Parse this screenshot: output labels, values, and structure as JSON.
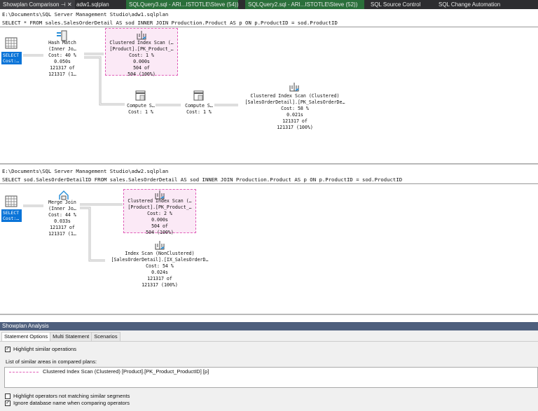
{
  "tabs": [
    {
      "label": "Showplan Comparison",
      "pin": "⊣",
      "close": "✕"
    },
    {
      "label": "adw1.sqlplan"
    },
    {
      "label": "SQLQuery3.sql - ARI...ISTOTLE\\Steve (54))"
    },
    {
      "label": "SQLQuery2.sql - ARI...ISTOTLE\\Steve (52))"
    },
    {
      "label": "SQL Source Control"
    },
    {
      "label": "SQL Change Automation"
    }
  ],
  "plan1": {
    "path": "E:\\Documents\\SQL Server Management Studio\\adw1.sqlplan",
    "query": "SELECT * FROM sales.SalesOrderDetail AS sod INNER JOIN Production.Product AS p ON p.ProductID = sod.ProductID",
    "select": {
      "l1": "SELECT",
      "l2": "Cost:…"
    },
    "hash": {
      "l1": "Hash Match",
      "l2": "(Inner Jo…",
      "l3": "Cost: 40 %",
      "l4": "0.050s",
      "l5": "121317 of",
      "l6": "121317 (1…"
    },
    "cis_product": {
      "l1": "Clustered Index Scan (…",
      "l2": "[Product].[PK_Product_…",
      "l3": "Cost: 1 %",
      "l4": "0.000s",
      "l5": "504 of",
      "l6": "504 (100%)"
    },
    "compute1": {
      "l1": "Compute S…",
      "l2": "Cost: 1 %"
    },
    "compute2": {
      "l1": "Compute S…",
      "l2": "Cost: 1 %"
    },
    "cis_sod": {
      "l1": "Clustered Index Scan (Clustered)",
      "l2": "[SalesOrderDetail].[PK_SalesOrderDe…",
      "l3": "Cost: 58 %",
      "l4": "0.021s",
      "l5": "121317 of",
      "l6": "121317 (100%)"
    }
  },
  "plan2": {
    "path": "E:\\Documents\\SQL Server Management Studio\\adw2.sqlplan",
    "query": "SELECT sod.SalesOrderDetailID FROM sales.SalesOrderDetail AS sod INNER JOIN Production.Product AS p ON p.ProductID = sod.ProductID",
    "select": {
      "l1": "SELECT",
      "l2": "Cost:…"
    },
    "merge": {
      "l1": "Merge Join",
      "l2": "(Inner Jo…",
      "l3": "Cost: 44 %",
      "l4": "0.033s",
      "l5": "121317 of",
      "l6": "121317 (1…"
    },
    "cis_product": {
      "l1": "Clustered Index Scan (…",
      "l2": "[Product].[PK_Product_…",
      "l3": "Cost: 2 %",
      "l4": "0.000s",
      "l5": "504 of",
      "l6": "504 (100%)"
    },
    "is_sod": {
      "l1": "Index Scan (NonClustered)",
      "l2": "[SalesOrderDetail].[IX_SalesOrderD…",
      "l3": "Cost: 54 %",
      "l4": "0.024s",
      "l5": "121317 of",
      "l6": "121317 (100%)"
    }
  },
  "analysis": {
    "title": "Showplan Analysis",
    "tabs": [
      "Statement Options",
      "Multi Statement",
      "Scenarios"
    ],
    "highlight_similar": {
      "label": "Highlight similar operations",
      "checked": true
    },
    "list_label": "List of similar areas in compared plans:",
    "list_items": [
      "Clustered Index Scan (Clustered) [Product].[PK_Product_ProductID] [p]"
    ],
    "highlight_not_matching": {
      "label": "Highlight operators not matching similar segments",
      "checked": false
    },
    "ignore_db": {
      "label": "Ignore database name when comparing operators",
      "checked": true
    }
  },
  "colors": {
    "highlight": "#e05fb8",
    "select": "#0a74d8",
    "tab_green": "#2a6f3a"
  }
}
